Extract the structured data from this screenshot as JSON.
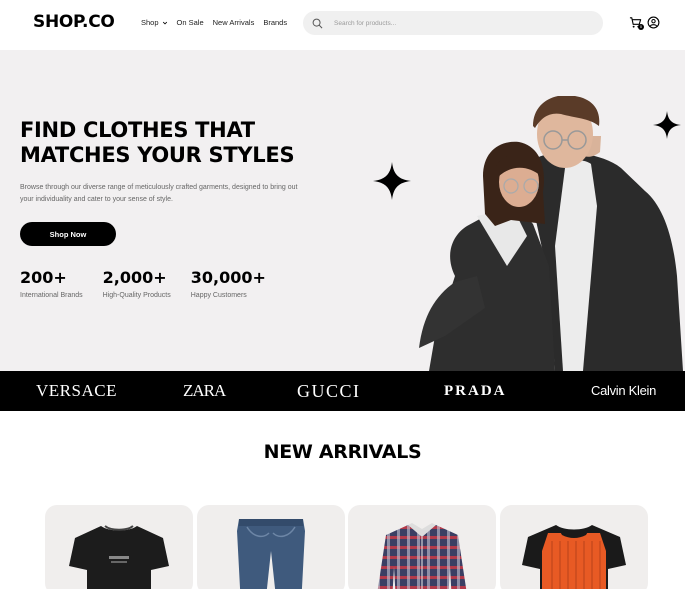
{
  "header": {
    "logo": "SHOP.CO",
    "nav": [
      "Shop",
      "On Sale",
      "New Arrivals",
      "Brands"
    ],
    "search_placeholder": "Search for products...",
    "cart_count": "0"
  },
  "hero": {
    "title_line1": "FIND CLOTHES THAT",
    "title_line2": "MATCHES YOUR STYLES",
    "description": "Browse through our diverse range of meticulously crafted garments, designed to bring out your individuality and cater to your sense of style.",
    "cta": "Shop Now",
    "stats": [
      {
        "value": "200+",
        "label": "International Brands"
      },
      {
        "value": "2,000+",
        "label": "High-Quality Products"
      },
      {
        "value": "30,000+",
        "label": "Happy Customers"
      }
    ]
  },
  "brands": [
    "VERSACE",
    "ZARA",
    "GUCCI",
    "PRADA",
    "Calvin Klein"
  ],
  "new_arrivals": {
    "title": "NEW ARRIVALS",
    "products": [
      {
        "icon": "black-tshirt"
      },
      {
        "icon": "blue-jeans"
      },
      {
        "icon": "plaid-shirt"
      },
      {
        "icon": "orange-black-tshirt"
      }
    ]
  },
  "colors": {
    "hero_bg": "#f2f0f1",
    "brand_bar_bg": "#000000",
    "product_card_bg": "#f0eeed",
    "search_bg": "#f0f0f0"
  }
}
